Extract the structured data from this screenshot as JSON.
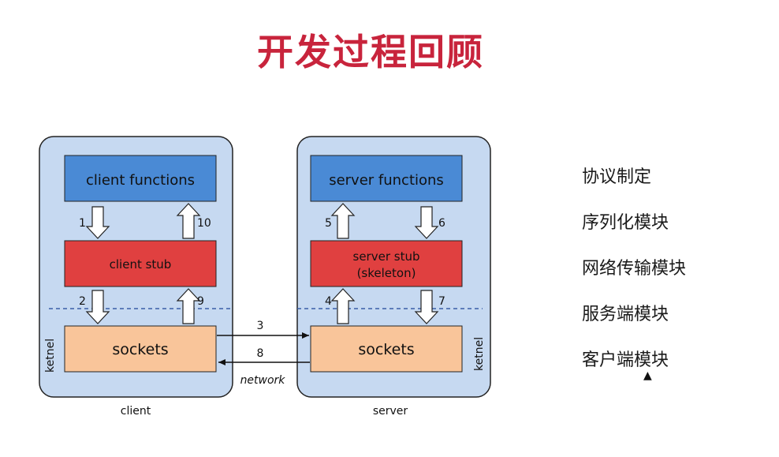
{
  "title": "开发过程回顾",
  "diagram": {
    "client": {
      "functions": "client functions",
      "stub": "client stub",
      "sockets": "sockets",
      "kernel": "ketnel",
      "caption": "client"
    },
    "server": {
      "functions": "server functions",
      "stub_line1": "server stub",
      "stub_line2": "(skeleton)",
      "sockets": "sockets",
      "kernel": "ketnel",
      "caption": "server"
    },
    "network": "network",
    "steps": [
      "1",
      "2",
      "3",
      "4",
      "5",
      "6",
      "7",
      "8",
      "9",
      "10"
    ],
    "colors": {
      "panel": "#c6d9f1",
      "functions": "#4a8ad5",
      "stub": "#e04040",
      "sockets": "#f9c59a",
      "divider": "#3a5fa8"
    }
  },
  "agenda": [
    "协议制定",
    "序列化模块",
    "网络传输模块",
    "服务端模块",
    "客户端模块"
  ]
}
